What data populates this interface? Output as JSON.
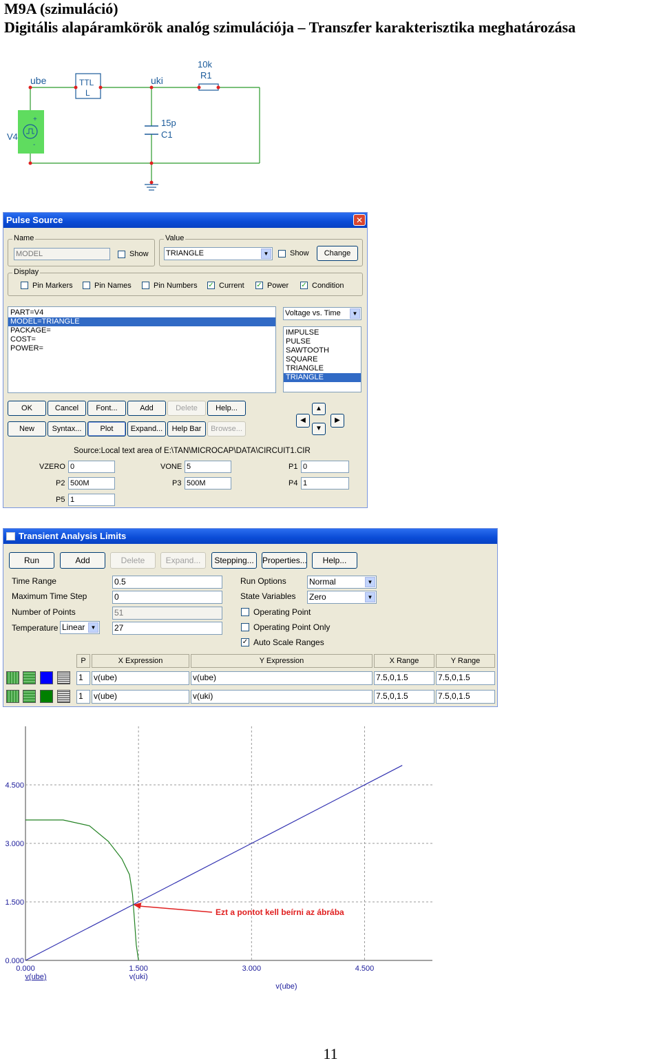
{
  "heading": {
    "line1": "M9A (szimuláció)",
    "line2": "Digitális alapáramkörök analóg szimulációja – Transzfer karakterisztika meghatározása"
  },
  "schematic": {
    "labels": {
      "ube": "ube",
      "uki": "uki",
      "ttl_top": "TTL",
      "ttl_bottom": "L",
      "r_value": "10k",
      "r_name": "R1",
      "c_value": "15p",
      "c_name": "C1",
      "v_name": "V4",
      "plus": "+",
      "minus": "-"
    }
  },
  "pulse_source": {
    "title": "Pulse Source",
    "close": "✕",
    "name_group": "Name",
    "name_value": "MODEL",
    "show1": "Show",
    "value_group": "Value",
    "value_value": "TRIANGLE",
    "show2": "Show",
    "change": "Change",
    "display_group": "Display",
    "display_options": [
      {
        "label": "Pin Markers",
        "checked": false
      },
      {
        "label": "Pin Names",
        "checked": false
      },
      {
        "label": "Pin Numbers",
        "checked": false
      },
      {
        "label": "Current",
        "checked": true
      },
      {
        "label": "Power",
        "checked": true
      },
      {
        "label": "Condition",
        "checked": true
      }
    ],
    "attributes": [
      "PART=V4",
      "MODEL=TRIANGLE",
      "PACKAGE=",
      "COST=",
      "POWER="
    ],
    "plot_type": "Voltage vs. Time",
    "models": [
      "IMPULSE",
      "PULSE",
      "SAWTOOTH",
      "SQUARE",
      "TRIANGLE",
      "TRIANGLE"
    ],
    "buttons_row1": [
      "OK",
      "Cancel",
      "Font...",
      "Add",
      "Delete",
      "Help..."
    ],
    "buttons_row2": [
      "New",
      "Syntax...",
      "Plot",
      "Expand...",
      "Help Bar",
      "Browse..."
    ],
    "source": "Source:Local text area of E:\\TAN\\MICROCAP\\DATA\\CIRCUIT1.CIR",
    "params": {
      "vzero_label": "VZERO",
      "vzero": "0",
      "vone_label": "VONE",
      "vone": "5",
      "p1_label": "P1",
      "p1": "0",
      "p2_label": "P2",
      "p2": "500M",
      "p3_label": "P3",
      "p3": "500M",
      "p4_label": "P4",
      "p4": "1",
      "p5_label": "P5",
      "p5": "1"
    }
  },
  "transient": {
    "title": "Transient Analysis Limits",
    "buttons": [
      "Run",
      "Add",
      "Delete",
      "Expand...",
      "Stepping...",
      "Properties...",
      "Help..."
    ],
    "time_range_label": "Time Range",
    "time_range": "0.5",
    "max_step_label": "Maximum Time Step",
    "max_step": "0",
    "num_points_label": "Number of Points",
    "num_points": "51",
    "temperature_label": "Temperature",
    "temperature_mode": "Linear",
    "temperature": "27",
    "run_options_label": "Run Options",
    "run_options": "Normal",
    "state_vars_label": "State Variables",
    "state_vars": "Zero",
    "op_point": "Operating Point",
    "op_point_only": "Operating Point Only",
    "auto_scale": "Auto Scale Ranges",
    "headers": {
      "p": "P",
      "x": "X Expression",
      "y": "Y Expression",
      "xr": "X Range",
      "yr": "Y Range"
    },
    "rows": [
      {
        "p": "1",
        "x": "v(ube)",
        "y": "v(ube)",
        "xr": "7.5,0,1.5",
        "yr": "7.5,0,1.5",
        "color": "#0000ff"
      },
      {
        "p": "1",
        "x": "v(ube)",
        "y": "v(uki)",
        "xr": "7.5,0,1.5",
        "yr": "7.5,0,1.5",
        "color": "#008000"
      }
    ]
  },
  "chart_data": {
    "type": "line",
    "xlim": [
      0,
      5.4
    ],
    "ylim": [
      0,
      6.0
    ],
    "xticks": [
      "0.000",
      "1.500",
      "3.000",
      "4.500"
    ],
    "yticks": [
      "0.000",
      "1.500",
      "3.000",
      "4.500"
    ],
    "xlabel": "v(ube)",
    "series": [
      {
        "name": "v(ube)",
        "color": "#3030b0",
        "x": [
          0,
          5.0
        ],
        "y": [
          0,
          5.0
        ]
      },
      {
        "name": "v(uki)",
        "color": "#208020",
        "x": [
          0,
          0.5,
          0.85,
          1.1,
          1.28,
          1.38,
          1.42,
          1.44,
          1.47,
          1.5
        ],
        "y": [
          3.6,
          3.6,
          3.45,
          3.05,
          2.6,
          2.2,
          1.7,
          1.2,
          0.4,
          0.0
        ]
      }
    ],
    "annotation": {
      "text": "Ezt a pontot kell beírni az ábrába",
      "x": 1.43,
      "y": 1.43
    }
  },
  "page_number": "11"
}
